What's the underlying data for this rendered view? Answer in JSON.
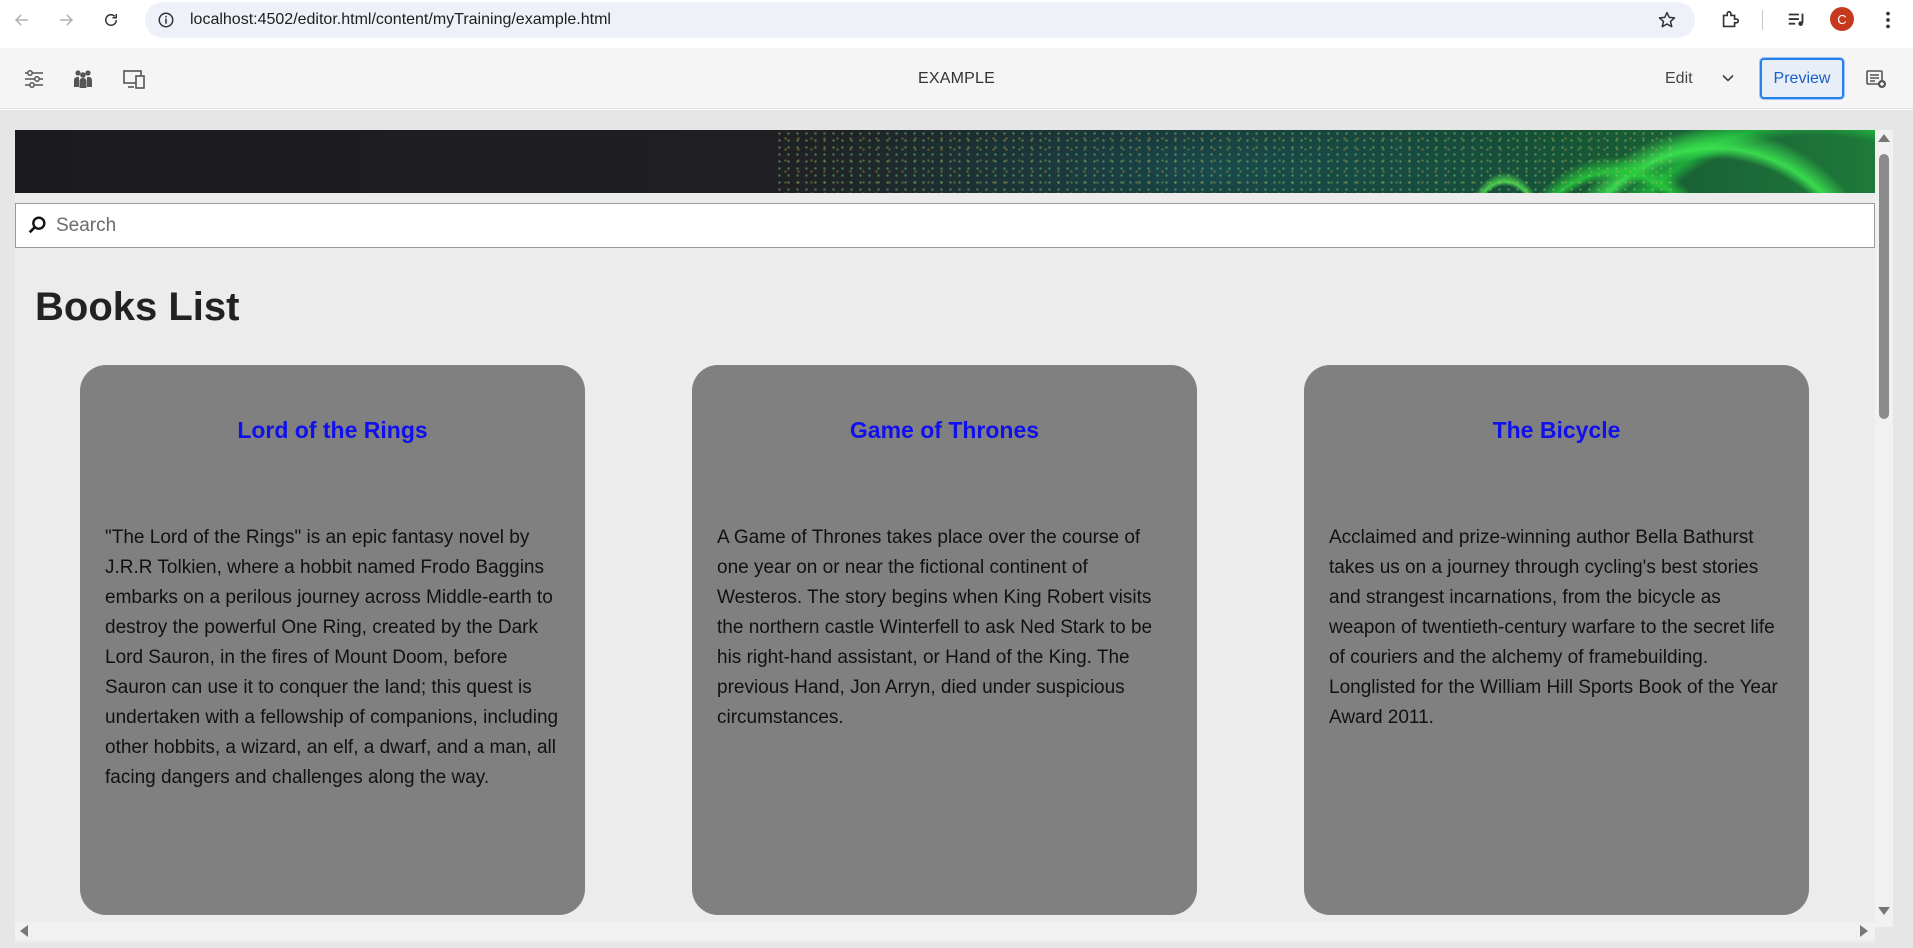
{
  "browser": {
    "url": "localhost:4502/editor.html/content/myTraining/example.html",
    "profile_initial": "C",
    "icons": [
      "back-arrow-icon",
      "forward-arrow-icon",
      "reload-icon",
      "info-icon",
      "star-icon",
      "extensions-icon",
      "media-queue-icon",
      "more-vert-icon"
    ]
  },
  "editor": {
    "page_title": "EXAMPLE",
    "mode_label": "Edit",
    "preview_label": "Preview",
    "icons": [
      "page-properties-icon",
      "users-icon",
      "emulator-icon",
      "annotations-icon"
    ],
    "accent_color": "#2680eb"
  },
  "page": {
    "search_placeholder": "Search",
    "heading": "Books List",
    "books": [
      {
        "title": "Lord of the Rings",
        "description": "\"The Lord of the Rings\" is an epic fantasy novel by J.R.R Tolkien, where a hobbit named Frodo Baggins embarks on a perilous journey across Middle-earth to destroy the powerful One Ring, created by the Dark Lord Sauron, in the fires of Mount Doom, before Sauron can use it to conquer the land; this quest is undertaken with a fellowship of companions, including other hobbits, a wizard, an elf, a dwarf, and a man, all facing dangers and challenges along the way."
      },
      {
        "title": "Game of Thrones",
        "description": "A Game of Thrones takes place over the course of one year on or near the fictional continent of Westeros. The story begins when King Robert visits the northern castle Winterfell to ask Ned Stark to be his right-hand assistant, or Hand of the King. The previous Hand, Jon Arryn, died under suspicious circumstances."
      },
      {
        "title": "The Bicycle",
        "description": "Acclaimed and prize-winning author Bella Bathurst takes us on a journey through cycling's best stories and strangest incarnations, from the bicycle as weapon of twentieth-century warfare to the secret life of couriers and the alchemy of framebuilding. Longlisted for the William Hill Sports Book of the Year Award 2011."
      }
    ],
    "card_color": "#808080",
    "title_color": "#1010ee"
  }
}
